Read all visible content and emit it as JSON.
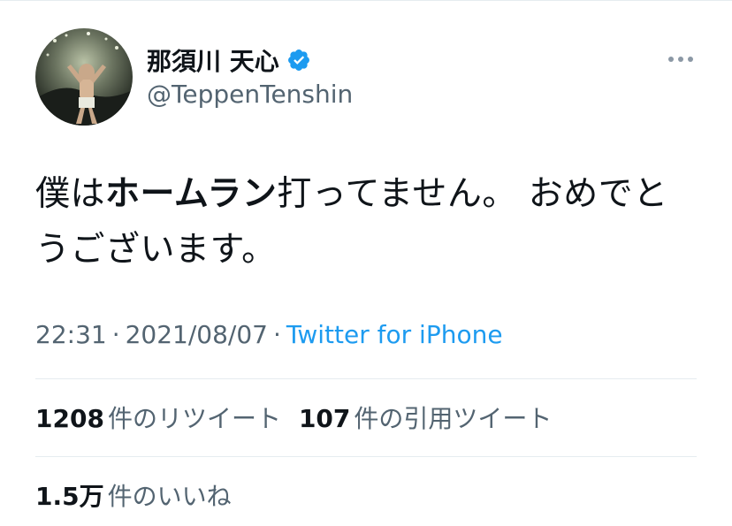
{
  "user": {
    "display_name": "那須川 天心",
    "handle": "@TeppenTenshin",
    "verified": true
  },
  "tweet": {
    "text_pre": "僕は",
    "text_bold": "ホームラン",
    "text_post": "打ってません。 おめでとうございます。"
  },
  "meta": {
    "time": "22:31",
    "date": "2021/08/07",
    "separator": "·",
    "source": "Twitter for iPhone"
  },
  "stats": {
    "retweets_count": "1208",
    "retweets_label": "件のリツイート",
    "quotes_count": "107",
    "quotes_label": "件の引用ツイート",
    "likes_count": "1.5万",
    "likes_label": "件のいいね"
  },
  "colors": {
    "text": "#0f1419",
    "secondary": "#536471",
    "link": "#1d9bf0",
    "divider": "#e6ecf0"
  },
  "icons": {
    "verified": "verified-badge-icon",
    "more": "more-horizontal-icon"
  }
}
